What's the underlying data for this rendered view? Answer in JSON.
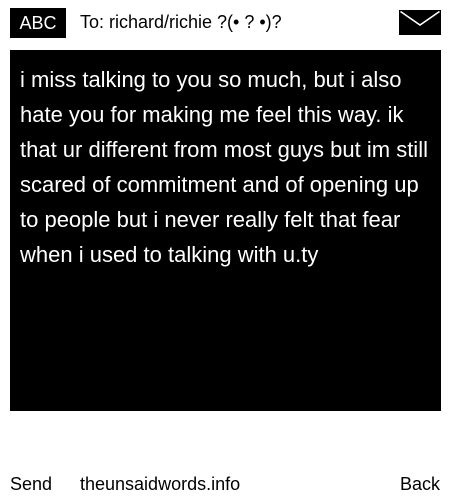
{
  "header": {
    "mode_label": "ABC",
    "recipient": "To: richard/richie ?(• ? •)?",
    "icon": "envelope-icon"
  },
  "message": {
    "body": "i miss talking to you so much, but i also hate you for making me feel this way. ik that ur different from most guys but im still scared of commitment and of opening up to people but i never really felt that fear when i used to talking with u.ty"
  },
  "softkeys": {
    "left": "Send",
    "center": "theunsaidwords.info",
    "right": "Back"
  },
  "colors": {
    "background": "#ffffff",
    "message_background": "#000000",
    "message_text": "#ffffff"
  }
}
